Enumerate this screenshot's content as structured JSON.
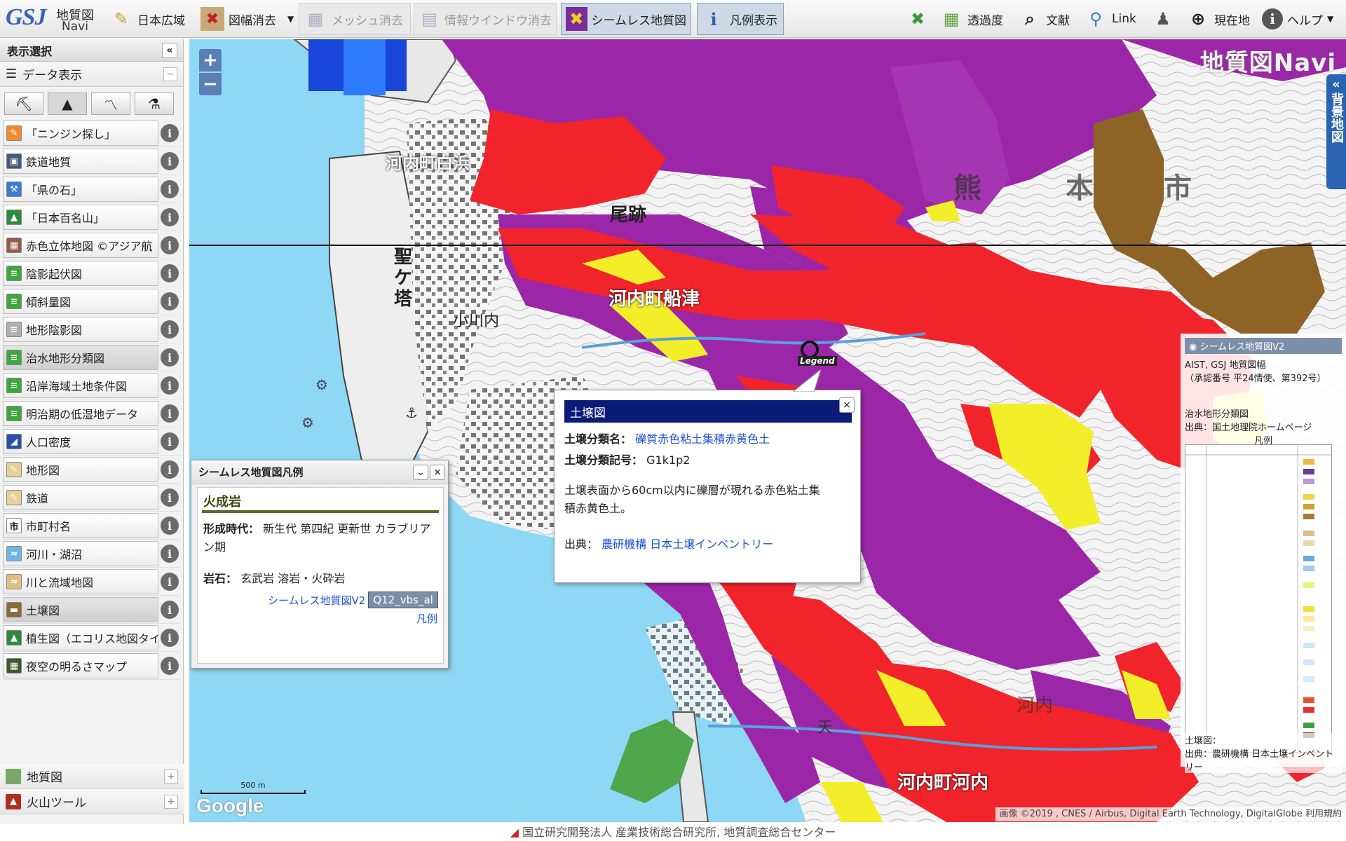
{
  "toolbar": {
    "logo_line1": "地質図",
    "logo_line2": "Navi",
    "logo_gsj": "GSJ",
    "buttons": [
      {
        "label": "日本広域",
        "icon": "japan-map-icon"
      },
      {
        "label": "図幅消去",
        "icon": "map-sheet-icon"
      },
      {
        "label": "メッシュ消去",
        "icon": "mesh-icon"
      },
      {
        "label": "情報ウインドウ消去",
        "icon": "info-window-icon"
      },
      {
        "label": "シームレス地質図",
        "icon": "seamless-map-icon"
      },
      {
        "label": "凡例表示",
        "icon": "legend-icon"
      },
      {
        "label": "透過度",
        "icon": "transparency-icon"
      },
      {
        "label": "文献",
        "icon": "search-literature-icon"
      },
      {
        "label": "Link",
        "icon": "link-icon"
      },
      {
        "label": "現在地",
        "icon": "crosshair-icon"
      },
      {
        "label": "ヘルプ",
        "icon": "help-icon"
      }
    ]
  },
  "sidebar": {
    "title": "表示選択",
    "collapse": "«",
    "data_display": "データ表示",
    "layers": [
      {
        "label": "「ニンジン探し」",
        "color": "#f08a2a",
        "glyph": "✎"
      },
      {
        "label": "鉄道地質",
        "color": "#445a7a",
        "glyph": "▣"
      },
      {
        "label": "「県の石」",
        "color": "#3a7bd5",
        "glyph": "⚒"
      },
      {
        "label": "「日本百名山」",
        "color": "#2e8b3e",
        "glyph": "▲"
      },
      {
        "label": "赤色立体地図 ©アジア航",
        "color": "#9a5a4a",
        "glyph": "▦"
      },
      {
        "label": "陰影起伏図",
        "color": "#3aa83a",
        "glyph": "≡"
      },
      {
        "label": "傾斜量図",
        "color": "#3aa83a",
        "glyph": "≡"
      },
      {
        "label": "地形陰影図",
        "color": "#b0b0b0",
        "glyph": "≡"
      },
      {
        "label": "治水地形分類図",
        "color": "#3aa83a",
        "glyph": "≡"
      },
      {
        "label": "沿岸海域土地条件図",
        "color": "#3aa83a",
        "glyph": "≡"
      },
      {
        "label": "明治期の低湿地データ",
        "color": "#3aa83a",
        "glyph": "≡"
      },
      {
        "label": "人口密度",
        "color": "#2a4fa8",
        "glyph": "◢"
      },
      {
        "label": "地形図",
        "color": "#e8cf96",
        "glyph": "✎"
      },
      {
        "label": "鉄道",
        "color": "#e8cf96",
        "glyph": "✎"
      },
      {
        "label": "市町村名",
        "color": "#ffffff",
        "glyph": "市"
      },
      {
        "label": "河川・湖沼",
        "color": "#6fb5e8",
        "glyph": "≈"
      },
      {
        "label": "川と流域地図",
        "color": "#e0c080",
        "glyph": "≈"
      },
      {
        "label": "土壌図",
        "color": "#8a6a3a",
        "glyph": "▬"
      },
      {
        "label": "植生図（エコリス地図タイル）",
        "color": "#2e8b3e",
        "glyph": "▲"
      },
      {
        "label": "夜空の明るさマップ",
        "color": "#3a5a2a",
        "glyph": "▦"
      }
    ],
    "bottom_groups": [
      {
        "label": "地質図",
        "toggle": "+"
      },
      {
        "label": "火山ツール",
        "toggle": "+"
      }
    ]
  },
  "map": {
    "zoom_in": "+",
    "zoom_out": "−",
    "watermark": "地質図Navi",
    "bg_tab": "背景地図",
    "bg_tab_arrow": "«",
    "place_labels": [
      "河内町白浜",
      "尾跡",
      "熊",
      "本",
      "市",
      "聖ケ塔",
      "小川内",
      "河内町船津",
      "河内町河内",
      "河内",
      "天"
    ],
    "scale": "500 m",
    "google": "Google",
    "attribution": "画像 ©2019 , CNES / Airbus, Digital Earth Technology, DigitalGlobe  利用規約",
    "legend_marker": "Legend"
  },
  "soil_popup": {
    "title": "土壌図",
    "name_key": "土壌分類名：",
    "name_val": "礫質赤色粘土集積赤黄色土",
    "code_key": "土壌分類記号：",
    "code_val": "G1k1p2",
    "desc": "土壌表面から60cm以内に礫層が現れる赤色粘土集積赤黄色土。",
    "source_key": "出典：",
    "source_val": "農研機構 日本土壌インベントリー",
    "close": "×"
  },
  "legend_popup": {
    "title": "シームレス地質図凡例",
    "heading": "火成岩",
    "era_key": "形成時代：",
    "era_val": "新生代 第四紀 更新世 カラブリアン期",
    "rock_key": "岩石：",
    "rock_val": "玄武岩 溶岩・火砕岩",
    "link_text": "シームレス地質図V2",
    "code": "Q12_vbs_al",
    "legend_link": "凡例"
  },
  "right_legend": {
    "seamless": "シームレス地質図V2",
    "aist": "AIST, GSJ 地質図幅",
    "approval": "（承認番号 平24情使、第392号）",
    "flood_title": "治水地形分類図",
    "flood_src": "出典：国土地理院ホームページ",
    "hanrei": "凡例",
    "soil_title": "土壌図：",
    "soil_src": "出典：農研機構 日本土壌インベントリー"
  },
  "footer": {
    "text": "国立研究開発法人 産業技術総合研究所,  地質調査総合センター"
  },
  "colors": {
    "water": "#8ed8f5",
    "purple": "#9b27a8",
    "red": "#f0242a",
    "yellow": "#f2ee2a",
    "brown": "#8d6326",
    "green": "#4fa64a",
    "popup_title": "#0b1c78"
  }
}
